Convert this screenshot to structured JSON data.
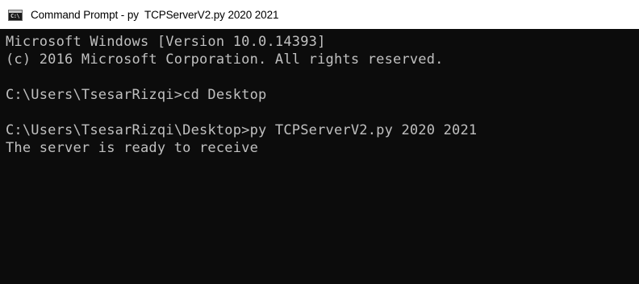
{
  "window": {
    "title": "Command Prompt - py  TCPServerV2.py 2020 2021",
    "icon": "cmd-icon",
    "icon_glyph": "C:\\"
  },
  "console": {
    "background": "#0c0c0c",
    "foreground": "#c0c0c0",
    "lines": [
      "Microsoft Windows [Version 10.0.14393]",
      "(c) 2016 Microsoft Corporation. All rights reserved.",
      "",
      "C:\\Users\\TsesarRizqi>cd Desktop",
      "",
      "C:\\Users\\TsesarRizqi\\Desktop>py TCPServerV2.py 2020 2021",
      "The server is ready to receive"
    ]
  }
}
